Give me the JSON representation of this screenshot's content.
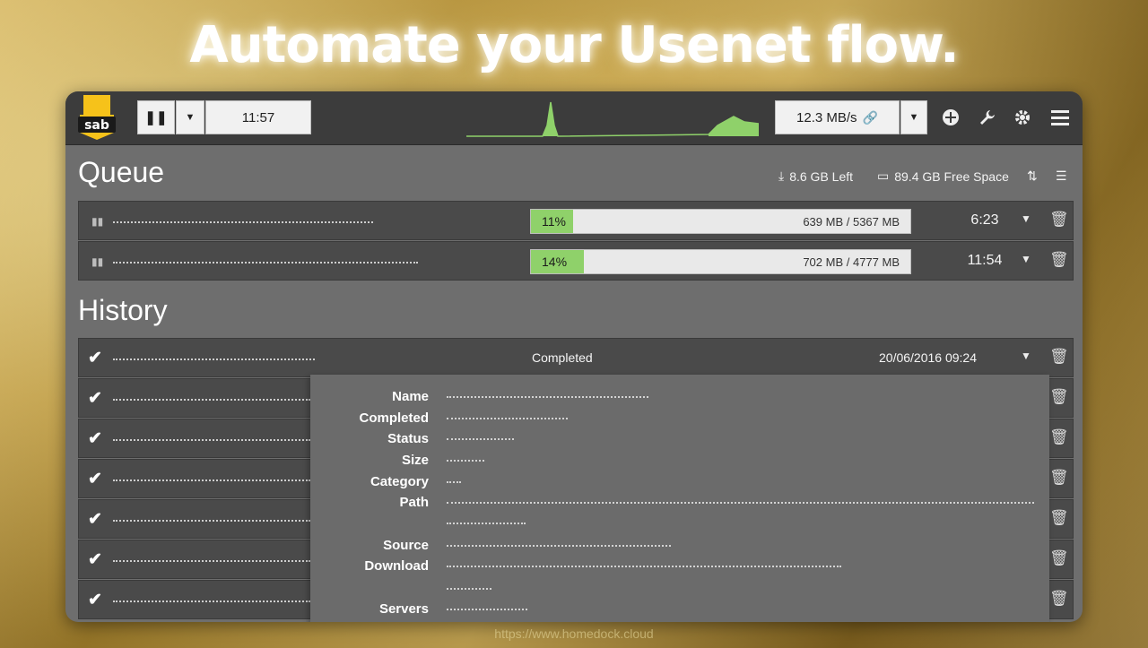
{
  "headline": "Automate your Usenet flow.",
  "footer_url": "https://www.homedock.cloud",
  "logo_text": "sab",
  "toolbar": {
    "pause_label": "❚❚",
    "time": "11:57",
    "speed": "12.3 MB/s",
    "icons": [
      "add-icon",
      "wrench-icon",
      "gear-icon",
      "menu-icon"
    ]
  },
  "queue": {
    "title": "Queue",
    "left": "8.6 GB Left",
    "free_space": "89.4 GB Free Space",
    "items": [
      {
        "percent": "11%",
        "progress": 0.11,
        "size": "639 MB / 5367 MB",
        "eta": "6:23"
      },
      {
        "percent": "14%",
        "progress": 0.14,
        "size": "702 MB / 4777 MB",
        "eta": "11:54"
      }
    ]
  },
  "history": {
    "title": "History",
    "first": {
      "status": "Completed",
      "date": "20/06/2016 09:24"
    },
    "details_labels": {
      "name": "Name",
      "completed": "Completed",
      "status": "Status",
      "size": "Size",
      "category": "Category",
      "path": "Path",
      "source": "Source",
      "download": "Download",
      "servers": "Servers"
    }
  },
  "colors": {
    "progress_fill": "#8fd16a",
    "accent": "#f6c21a",
    "topbar": "#3c3c3c"
  }
}
